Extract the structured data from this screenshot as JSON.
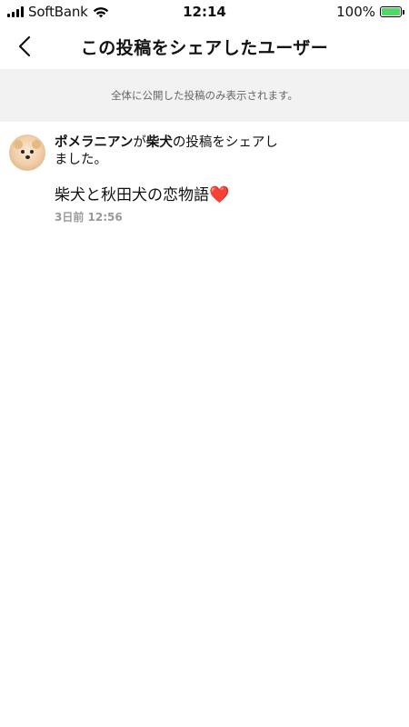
{
  "status_bar": {
    "carrier": "SoftBank",
    "time": "12:14",
    "battery_percent": "100%"
  },
  "nav": {
    "title": "この投稿をシェアしたユーザー",
    "back_icon": "chevron-left-icon"
  },
  "notice": {
    "text": "全体に公開した投稿のみ表示されます。"
  },
  "share": {
    "user": "ポメラニアン",
    "connector1": "が",
    "owner": "柴犬",
    "connector2": "の投稿をシェアし",
    "line2": "ました。",
    "post_title": "柴犬と秋田犬の恋物語",
    "post_emoji": "❤️",
    "timestamp": "3日前 12:56"
  },
  "colors": {
    "notice_bg": "#f2f2f2",
    "heart": "#e0262a",
    "battery_fill": "#4cd964"
  }
}
